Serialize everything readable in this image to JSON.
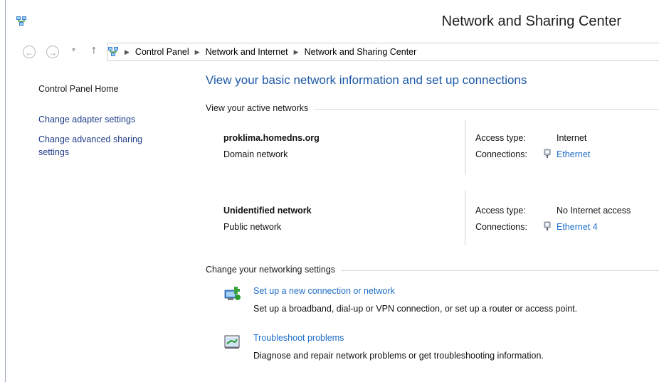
{
  "window": {
    "title": "Network and Sharing Center",
    "app_icon": "network-icon"
  },
  "nav": {
    "back_icon": "back-arrow-icon",
    "forward_icon": "forward-arrow-icon",
    "recent_icon": "chevron-down-icon",
    "up_icon": "up-arrow-icon",
    "breadcrumb": [
      "Control Panel",
      "Network and Internet",
      "Network and Sharing Center"
    ]
  },
  "sidebar": {
    "home": "Control Panel Home",
    "links": [
      "Change adapter settings",
      "Change advanced sharing",
      "settings"
    ]
  },
  "main": {
    "heading": "View your basic network information and set up connections",
    "active_label": "View your active networks",
    "networks": [
      {
        "name": "proklima.homedns.org",
        "type": "Domain network",
        "access_label": "Access type:",
        "access": "Internet",
        "conn_label": "Connections:",
        "connection": "Ethernet"
      },
      {
        "name": "Unidentified network",
        "type": "Public network",
        "access_label": "Access type:",
        "access": "No Internet access",
        "conn_label": "Connections:",
        "connection": "Ethernet 4"
      }
    ],
    "settings_label": "Change your networking settings",
    "tasks": [
      {
        "title": "Set up a new connection or network",
        "desc": "Set up a broadband, dial-up or VPN connection, or set up a router or access point.",
        "icon": "new-connection-icon"
      },
      {
        "title": "Troubleshoot problems",
        "desc": "Diagnose and repair network problems or get troubleshooting information.",
        "icon": "troubleshoot-icon"
      }
    ]
  },
  "colors": {
    "link": "#1e6ec8",
    "heading": "#1e5aa8",
    "sidebar_link": "#1f3c88"
  }
}
